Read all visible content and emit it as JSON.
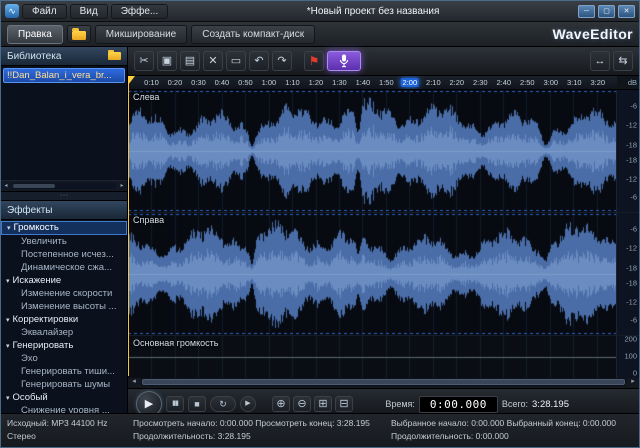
{
  "titlebar": {
    "menus": [
      "Файл",
      "Вид",
      "Эффе..."
    ],
    "title": "*Новый проект без названия",
    "minimize_glyph": "─",
    "maximize_glyph": "▢",
    "close_glyph": "✕"
  },
  "tabbar": {
    "tabs": [
      "Правка",
      "Микширование",
      "Создать компакт-диск"
    ],
    "active_tab": "Правка",
    "logo": "WaveEditor"
  },
  "library": {
    "header": "Библиотека",
    "items": [
      "!!Dan_Balan_i_vera_br..."
    ],
    "selected_item": "!!Dan_Balan_i_vera_br..."
  },
  "effects": {
    "header": "Эффекты",
    "tree": [
      {
        "label": "Громкость",
        "group": true,
        "selected": true
      },
      {
        "label": "Увеличить"
      },
      {
        "label": "Постепенное исчез..."
      },
      {
        "label": "Динамическое сжа..."
      },
      {
        "label": "Искажение",
        "group": true
      },
      {
        "label": "Изменение скорости"
      },
      {
        "label": "Изменение высоты ..."
      },
      {
        "label": "Корректировки",
        "group": true
      },
      {
        "label": "Эквалайзер"
      },
      {
        "label": "Генерировать",
        "group": true
      },
      {
        "label": "Эхо"
      },
      {
        "label": "Генерировать тиши..."
      },
      {
        "label": "Генерировать шумы"
      },
      {
        "label": "Особый",
        "group": true
      },
      {
        "label": "Снижение уровня ..."
      }
    ]
  },
  "toolbar": {
    "buttons": [
      {
        "name": "cut-icon",
        "glyph": "✂"
      },
      {
        "name": "copy-icon",
        "glyph": "▣"
      },
      {
        "name": "paste-icon",
        "glyph": "▤"
      },
      {
        "name": "delete-icon",
        "glyph": "✕"
      },
      {
        "name": "trim-icon",
        "glyph": "▭"
      },
      {
        "name": "undo-icon",
        "glyph": "↶"
      },
      {
        "name": "redo-icon",
        "glyph": "↷"
      }
    ],
    "marker_flag_glyph": "⚑",
    "right_buttons": [
      {
        "name": "fit-width-icon",
        "glyph": "↔"
      },
      {
        "name": "fit-selection-icon",
        "glyph": "⇆"
      }
    ]
  },
  "ruler": {
    "ticks": [
      "0:10",
      "0:20",
      "0:30",
      "0:40",
      "0:50",
      "1:00",
      "1:10",
      "1:20",
      "1:30",
      "1:40",
      "1:50",
      "2:00",
      "2:10",
      "2:20",
      "2:30",
      "2:40",
      "2:50",
      "3:00",
      "3:10",
      "3:20"
    ],
    "highlighted_tick": "2:00",
    "total_seconds": 208.195
  },
  "channels": {
    "left_label": "Слева",
    "right_label": "Справа",
    "master_label": "Основная громкость"
  },
  "scales": {
    "db_unit": "dB",
    "db_ticks_upper": [
      "-6",
      "-12",
      "-18"
    ],
    "db_ticks_lower": [
      "-18",
      "-12",
      "-6"
    ],
    "master_ticks": [
      "200",
      "100",
      "0"
    ]
  },
  "transport": {
    "play": "▶",
    "pause": "▮▮",
    "stop": "■",
    "loop": "↻",
    "play_small": "▶",
    "zoom_in": "⊕",
    "zoom_out": "⊖",
    "zoom_sel": "⊞",
    "zoom_all": "⊟",
    "time_label": "Время:",
    "time_value": "0:00.000",
    "total_label": "Всего:",
    "total_value": "3:28.195"
  },
  "icons": {
    "app_glyph": "∿",
    "scroll_left": "◂",
    "scroll_right": "▸",
    "tree_chevron": "▾",
    "splitter_grip": "⋯"
  },
  "statusbar": {
    "col1_line1": "Исходный: MP3 44100 Hz",
    "col1_line2": "Стерео",
    "col2_line1": "Просмотреть начало: 0:00.000  Просмотреть конец: 3:28.195",
    "col2_line2": "Продолжительность: 3:28.195",
    "col3_line1": "Выбранное начало: 0:00.000  Выбранный конец: 0:00.000",
    "col3_line2": "Продолжительность: 0:00.000"
  },
  "colors": {
    "waveform": "#4a6da8",
    "waveform_core": "#6a8cc0",
    "accent_blue": "#1e63d8",
    "record_purple": "#7a4fd0",
    "playhead_yellow": "#f5c33c",
    "selection_blue": "#2f6bdf"
  }
}
